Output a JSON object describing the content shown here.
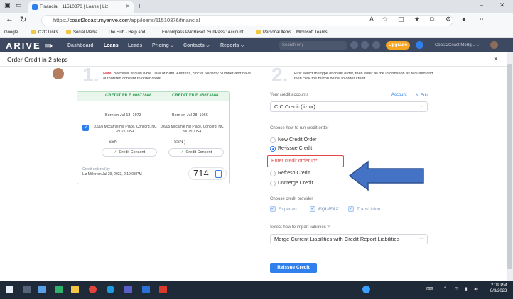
{
  "browser": {
    "tab_title": "Financial | 11510376 | Loans | Liz",
    "url_prefix": "https://",
    "url_host": "coast2coast.myarive.com",
    "url_path": "/app/loans/11510376/financial",
    "bookmarks": [
      "Google",
      "C2C Links",
      "Social Media",
      "The Hub - Help and...",
      "Encompass PW Reset",
      "SunPass : Account...",
      "Personal Items",
      "Microsoft Teams"
    ]
  },
  "app": {
    "logo": "ARIVE",
    "nav": [
      "Dashboard",
      "Loans",
      "Leads",
      "Pricing ⌵",
      "Contacts ⌵",
      "Reports ⌵"
    ],
    "search_placeholder": "Search or j",
    "upgrade_label": "Upgrade",
    "company": "Coast2Coast Mortg... ⌵"
  },
  "modal": {
    "title": "Order Credit in 2 steps"
  },
  "step1": {
    "number": "1.",
    "note_label": "Note:",
    "note_text": " Borrower should have Date of Birth, Address, Social Security Number and have authorized consent to order credit.",
    "files": [
      {
        "header": "CREDIT FILE #6673888",
        "born": "Born on Jul 13, 1973",
        "address": "10905 Mccamie Hill Place, Concord, NC 28025, USA",
        "ssn": "SSN",
        "consent": "Credit Consent"
      },
      {
        "header": "CREDIT FILE #6673888",
        "born": "Born on Jul 28, 1966",
        "address": "10905 Mccamie Hill Place, Concord, NC 28025, USA",
        "ssn": "SSN  )",
        "consent": "Credit Consent"
      }
    ],
    "ordered_by_label": "Credit ordered by",
    "ordered_by_value": "Liz Miller on Jul 29, 2023, 2:19:08 PM",
    "score": "714"
  },
  "step2": {
    "number": "2.",
    "instructions": "First select the type of credit order, then enter all the information as required and then click the button below to order credit",
    "accounts_label": "Your credit accounts",
    "add_account": "+ Account",
    "edit": "✎ Edit",
    "account_value": "CIC Credit (lizmr)",
    "run_label": "Choose how to run credit order",
    "options": [
      "New Credit Order",
      "Re-issue Credit",
      "Refresh Credit",
      "Unmerge Credit"
    ],
    "selected_option": "Re-issue Credit",
    "order_id_placeholder": "Enter credit order Id*",
    "provider_label": "Choose credit provider",
    "providers": [
      "Experian",
      "EQUIFAX",
      "TransUnion"
    ],
    "liabilities_label": "Select how to import liabilities ?",
    "liabilities_value": "Merge Current Liabilities with Credit Report Liabilities",
    "submit_label": "Reissue Credit"
  },
  "taskbar": {
    "time": "2:09 PM",
    "date": "8/3/2023"
  },
  "colors": {
    "nav_bg": "#3d4960",
    "accent": "#2f80ed",
    "success": "#2e9b4f",
    "error": "#e04848",
    "upgrade": "#f5a623"
  }
}
